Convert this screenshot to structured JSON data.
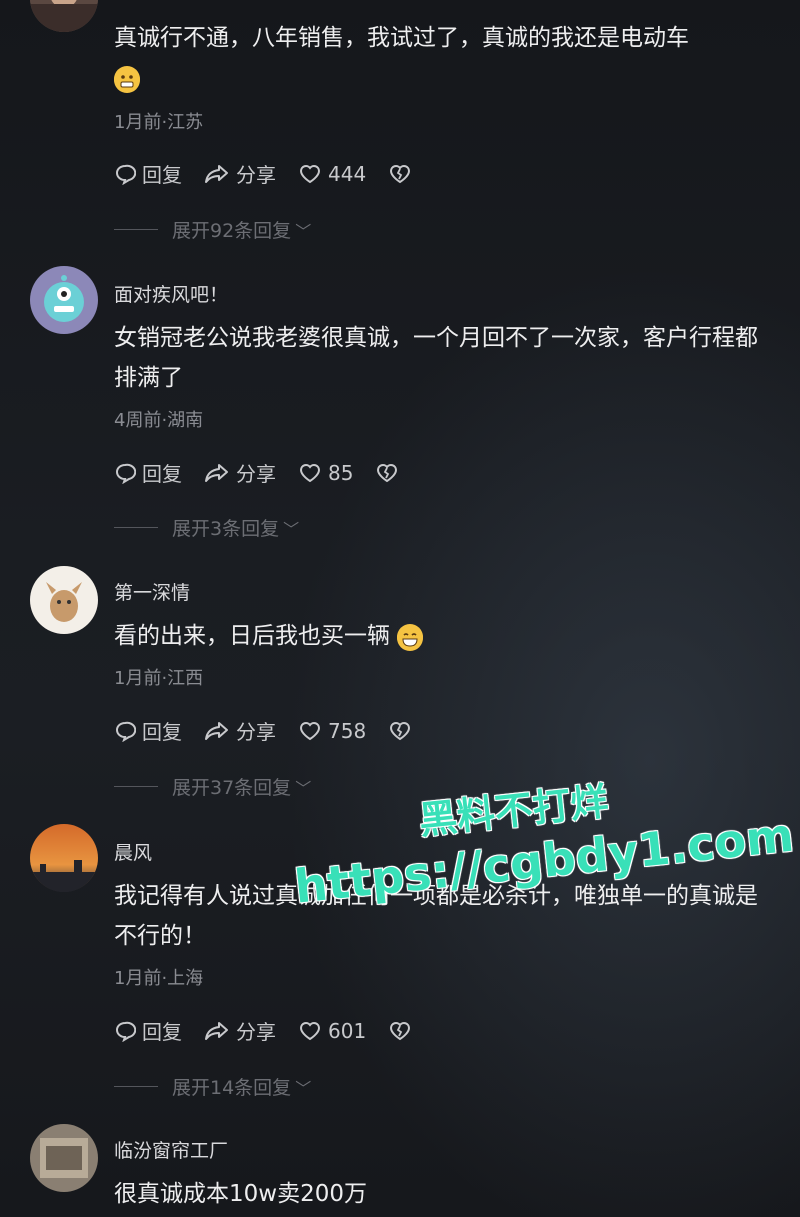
{
  "comments": [
    {
      "name": "",
      "text": "真诚行不通，八年销售，我试过了，真诚的我还是电动车",
      "emoji": "grimace-emoji",
      "meta": "1月前·江苏",
      "reply": "回复",
      "share": "分享",
      "likes": "444",
      "expand": "展开92条回复"
    },
    {
      "name": "面对疾风吧！",
      "text": "女销冠老公说我老婆很真诚，一个月回不了一次家，客户行程都排满了",
      "meta": "4周前·湖南",
      "reply": "回复",
      "share": "分享",
      "likes": "85",
      "expand": "展开3条回复"
    },
    {
      "name": "第一深情",
      "text": "看的出来，日后我也买一辆",
      "emoji": "grin-emoji",
      "meta": "1月前·江西",
      "reply": "回复",
      "share": "分享",
      "likes": "758",
      "expand": "展开37条回复"
    },
    {
      "name": "晨风",
      "text": "我记得有人说过真诚加任何一项都是必杀计，唯独单一的真诚是不行的！",
      "meta": "1月前·上海",
      "reply": "回复",
      "share": "分享",
      "likes": "601",
      "expand": "展开14条回复"
    },
    {
      "name": "临汾窗帘工厂",
      "text": "很真诚成本10w卖200万"
    }
  ],
  "watermark": {
    "line1": "黑料不打烊",
    "line2": "https://cgbdy1.com",
    "color": "#39e0b8"
  },
  "icons": {
    "reply": "reply-bubble-icon",
    "share": "share-arrow-icon",
    "like": "heart-icon",
    "dislike": "broken-heart-icon",
    "more": "more-dots-icon"
  }
}
